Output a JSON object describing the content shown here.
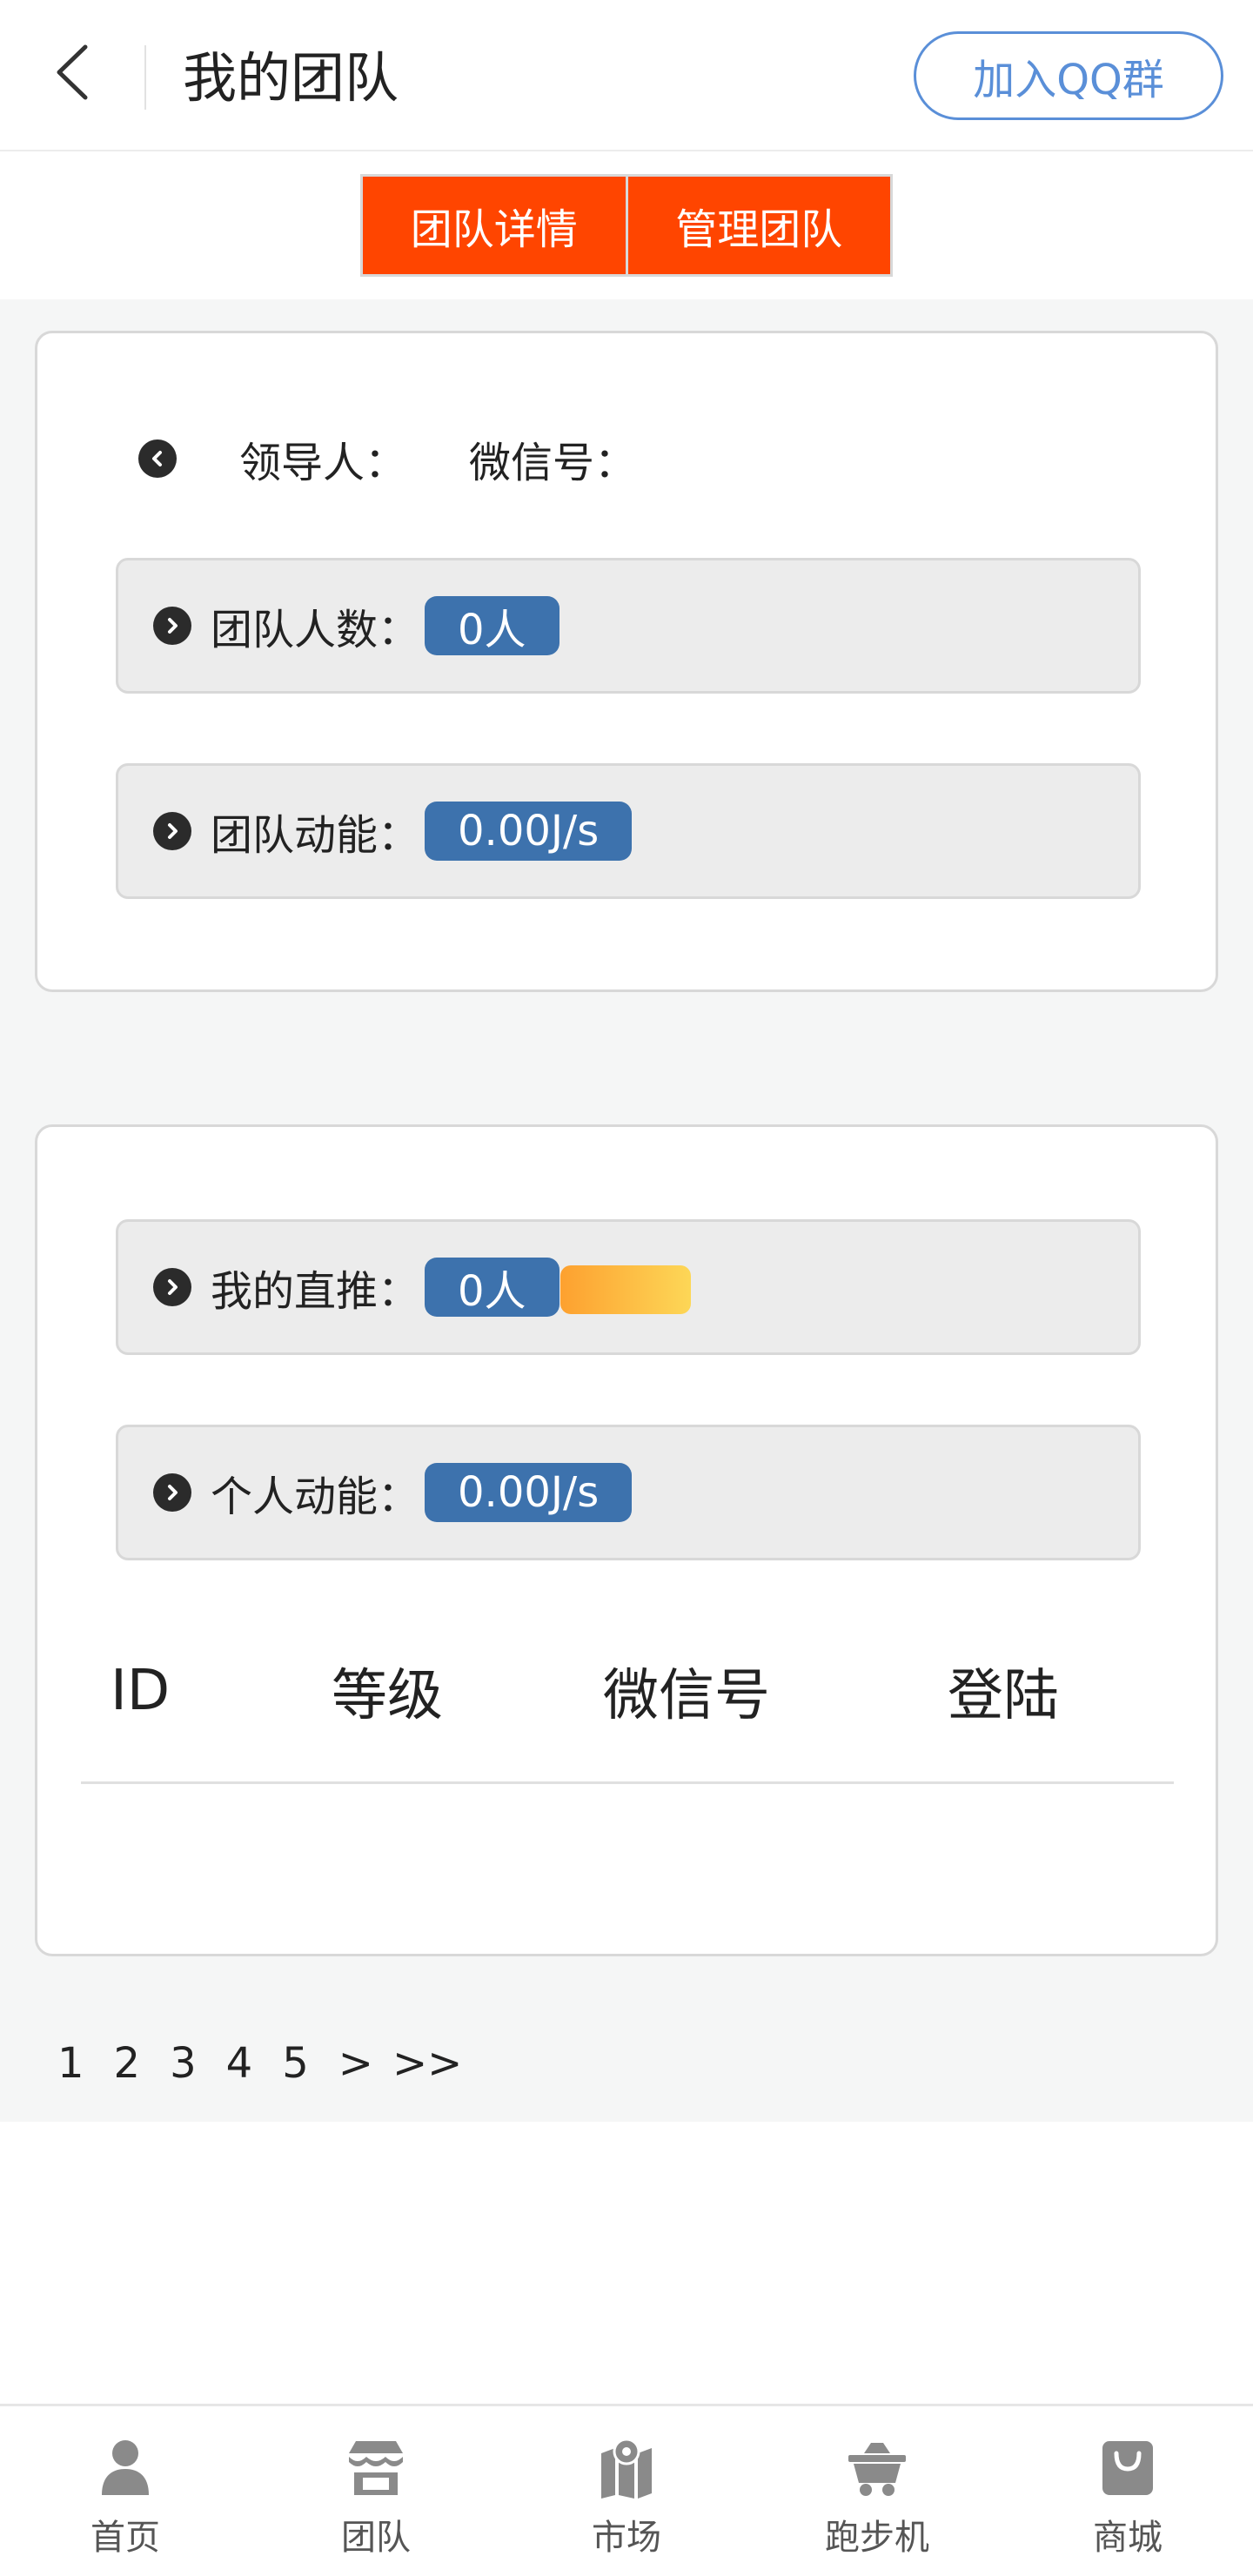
{
  "header": {
    "title": "我的团队",
    "qq_button": "加入QQ群",
    "back_icon": "back-arrow-icon"
  },
  "tabs": [
    {
      "label": "团队详情"
    },
    {
      "label": "管理团队"
    }
  ],
  "team_card": {
    "leader_label": "领导人：",
    "wechat_label": "微信号：",
    "stats": [
      {
        "label": "团队人数：",
        "value": "0人"
      },
      {
        "label": "团队动能：",
        "value": "0.00J/s"
      }
    ]
  },
  "personal_card": {
    "stats": [
      {
        "label": "我的直推：",
        "value": "0人"
      },
      {
        "label": "个人动能：",
        "value": "0.00J/s"
      }
    ],
    "table_headers": [
      "ID",
      "等级",
      "微信号",
      "登陆"
    ]
  },
  "pagination": [
    "1",
    "2",
    "3",
    "4",
    "5",
    ">",
    ">>"
  ],
  "bottom_nav": [
    {
      "label": "首页",
      "icon": "user-icon"
    },
    {
      "label": "团队",
      "icon": "store-icon"
    },
    {
      "label": "市场",
      "icon": "map-icon"
    },
    {
      "label": "跑步机",
      "icon": "mining-cart-icon"
    },
    {
      "label": "商城",
      "icon": "shopping-bag-icon"
    }
  ],
  "colors": {
    "accent": "#ff4500",
    "value_badge": "#3d72ad",
    "qq_button": "#5a8fd8"
  }
}
